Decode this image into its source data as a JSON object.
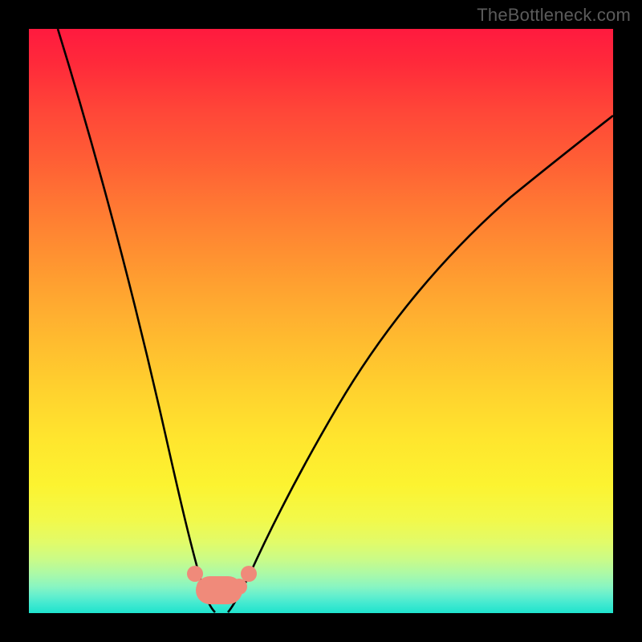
{
  "watermark": "TheBottleneck.com",
  "chart_data": {
    "type": "line",
    "title": "",
    "xlabel": "",
    "ylabel": "",
    "xlim": [
      0,
      100
    ],
    "ylim": [
      0,
      100
    ],
    "grid": false,
    "series": [
      {
        "name": "left-curve",
        "x": [
          5,
          10,
          15,
          20,
          22,
          24,
          26,
          27.5,
          29,
          30.5,
          32
        ],
        "values": [
          100,
          82,
          63,
          44,
          36,
          28,
          19,
          12,
          6,
          2,
          0
        ]
      },
      {
        "name": "right-curve",
        "x": [
          34,
          35.5,
          37.5,
          40,
          44,
          50,
          58,
          68,
          80,
          92,
          100
        ],
        "values": [
          0,
          3,
          8,
          15,
          26,
          40,
          54,
          65,
          75,
          82,
          86
        ]
      }
    ],
    "markers": {
      "name": "bottleneck-region",
      "color": "#f08a7a",
      "x": [
        27,
        29,
        31,
        33,
        35,
        37
      ],
      "values": [
        6,
        2.5,
        0.8,
        0.8,
        2.5,
        6
      ]
    }
  },
  "colors": {
    "curve": "#000000",
    "marker": "#f08a7a",
    "frame_bg": "#000000",
    "gradient_top": "#ff1a3f",
    "gradient_bottom": "#1ee3cd"
  }
}
